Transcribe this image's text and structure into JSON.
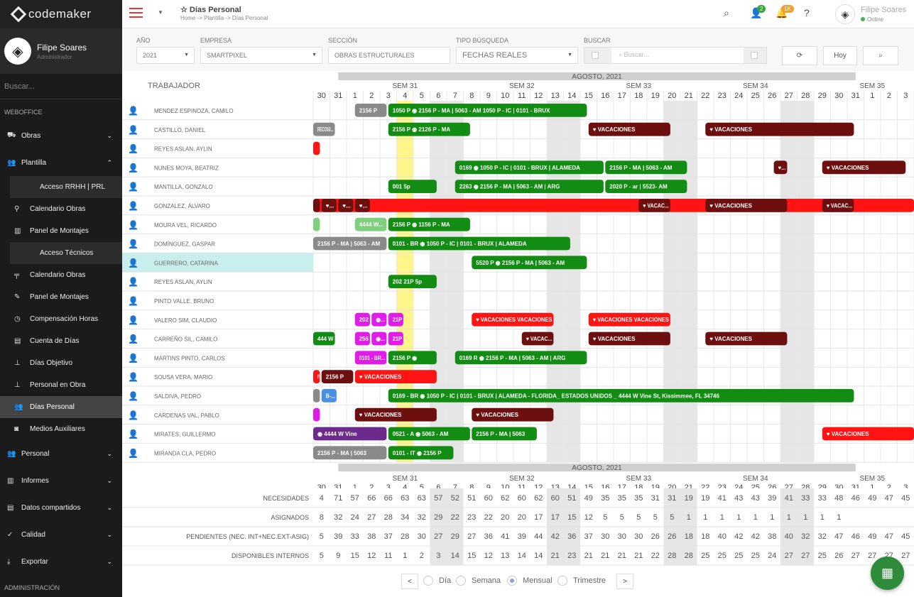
{
  "app": {
    "logo_text": "codemaker",
    "title": "Días Personal",
    "breadcrumb": "Home -> Plantilla -> Días Personal"
  },
  "colors": {
    "sidebar": "#1b1b1b",
    "accent": "#e53935",
    "green": "#138c13",
    "darkred": "#6e0f0f",
    "red": "#ff1414",
    "magenta": "#e11be8",
    "gray": "#8a8a8a",
    "purple": "#6b2a8c",
    "blue": "#4a90e2",
    "weekend": "#e6e6e6",
    "today": "#fff58a"
  },
  "sidebar": {
    "user_name": "Filipe Soares",
    "user_role": "Administrador",
    "search_placeholder": "Buscar...",
    "section1": "WEBOFFICE",
    "section2": "ADMINISTRACIÓN",
    "items": [
      {
        "label": "Obras",
        "icon": "truck-icon",
        "glyph": "⛟",
        "chevron": "⌄",
        "kind": "item"
      },
      {
        "label": "Plantilla",
        "icon": "users-icon",
        "glyph": "👥",
        "chevron": "⌃",
        "kind": "item"
      },
      {
        "label": "Acceso RRHH | PRL",
        "kind": "box"
      },
      {
        "label": "Calendario Obras",
        "icon": "map-pin-icon",
        "glyph": "⚲",
        "kind": "sub"
      },
      {
        "label": "Panel de Montajes",
        "icon": "chart-icon",
        "glyph": "▥",
        "kind": "sub"
      },
      {
        "label": "Acceso Técnicos",
        "kind": "box"
      },
      {
        "label": "Calendario Obras",
        "icon": "tool-icon",
        "glyph": "╤",
        "kind": "sub"
      },
      {
        "label": "Panel de Montajes",
        "icon": "pencil-icon",
        "glyph": "✎",
        "kind": "sub"
      },
      {
        "label": "Compensación Horas",
        "icon": "clock-icon",
        "glyph": "◷",
        "kind": "sub"
      },
      {
        "label": "Cuenta de Días",
        "icon": "calendar-icon",
        "glyph": "▤",
        "kind": "sub"
      },
      {
        "label": "Días Objetivo",
        "icon": "sitemap-icon",
        "glyph": "⊥",
        "kind": "sub"
      },
      {
        "label": "Personal en Obra",
        "icon": "sitemap-icon",
        "glyph": "⊥",
        "kind": "sub"
      },
      {
        "label": "Días Personal",
        "icon": "users-cog-icon",
        "glyph": "👥",
        "kind": "sub",
        "active": true
      },
      {
        "label": "Medios Auxiliares",
        "icon": "car-icon",
        "glyph": "◙",
        "kind": "sub"
      },
      {
        "label": "Personal",
        "icon": "user-group-icon",
        "glyph": "👥",
        "chevron": "⌄",
        "kind": "item"
      },
      {
        "label": "Informes",
        "icon": "bar-chart-icon",
        "glyph": "▥",
        "chevron": "⌄",
        "kind": "item"
      },
      {
        "label": "Datos compartidos",
        "icon": "database-icon",
        "glyph": "▤",
        "chevron": "⌄",
        "kind": "item"
      },
      {
        "label": "Calidad",
        "icon": "award-icon",
        "glyph": "✓",
        "chevron": "⌄",
        "kind": "item"
      },
      {
        "label": "Exportar",
        "icon": "download-icon",
        "glyph": "⤓",
        "chevron": "⌄",
        "kind": "item"
      }
    ]
  },
  "topbar": {
    "user_name": "Filipe Soares",
    "user_status": "Online",
    "badge_users": "2",
    "badge_alerts": "1K"
  },
  "filters": {
    "anio_label": "AÑO",
    "anio_value": "2021",
    "empresa_label": "EMPRESA",
    "empresa_value": "SMARTPIXEL",
    "seccion_label": "SECCIÓN",
    "seccion_value": "OBRAS ESTRUCTURALES",
    "tipo_label": "TIPO BÚSQUEDA",
    "tipo_value": "FECHAS REALES",
    "buscar_label": "BUSCAR",
    "buscar_placeholder": "Buscar...",
    "today_label": "Hoy"
  },
  "calendar": {
    "header_worker": "TRABAJADOR",
    "month": "AGOSTO, 2021",
    "days": [
      "30",
      "31",
      "1",
      "2",
      "3",
      "4",
      "5",
      "6",
      "7",
      "8",
      "9",
      "10",
      "11",
      "12",
      "13",
      "14",
      "15",
      "16",
      "17",
      "18",
      "19",
      "20",
      "21",
      "22",
      "23",
      "24",
      "25",
      "26",
      "27",
      "28",
      "29",
      "30",
      "31",
      "1",
      "2",
      "3"
    ],
    "weekend_idx": [
      7,
      8,
      14,
      15,
      21,
      22,
      28,
      29
    ],
    "today_idx": 5,
    "weeks": [
      {
        "label": "SEM 31",
        "day": 5
      },
      {
        "label": "SEM 32",
        "day": 12
      },
      {
        "label": "SEM 33",
        "day": 19
      },
      {
        "label": "SEM 34",
        "day": 26
      },
      {
        "label": "SEM 35",
        "day": 33
      }
    ],
    "workers": [
      {
        "name": "MENDEZ ESPINOZA, CAMILO",
        "events": [
          {
            "s": -1,
            "e": 0,
            "c": "#6ad2d2",
            "t": ""
          },
          {
            "s": 2.5,
            "e": 4.4,
            "c": "#8a8a8a",
            "t": "2156 P"
          },
          {
            "s": 4.5,
            "e": 16.4,
            "c": "#138c13",
            "t": "1050 P  ◉  2156 P - MA | 5063 - AM  1050 P - IC | 0101 - BRUX"
          }
        ]
      },
      {
        "name": "CASTILLO, DANIEL",
        "events": [
          {
            "s": -1,
            "e": 1.3,
            "c": "#8a8a8a",
            "t": "RECOGI..."
          },
          {
            "s": 4.5,
            "e": 9.4,
            "c": "#138c13",
            "t": "2156 P  ◉  2126 P - MA"
          },
          {
            "s": 16.5,
            "e": 21.4,
            "c": "#6e0f0f",
            "t": "♥ VACACIONES"
          },
          {
            "s": 23.5,
            "e": 32.4,
            "c": "#6e0f0f",
            "t": "♥ VACACIONES"
          }
        ]
      },
      {
        "name": "REYES ASLAN, AYLIN",
        "events": [
          {
            "s": -1,
            "e": 0.4,
            "c": "#ff1414",
            "t": ""
          }
        ]
      },
      {
        "name": "NUNES MOYA, BEATRIZ",
        "events": [
          {
            "s": 8.5,
            "e": 17.4,
            "c": "#138c13",
            "t": "0169  ◉  1050 P - IC | 0101 - BRUX | ALAMEDA"
          },
          {
            "s": 17.5,
            "e": 22.4,
            "c": "#138c13",
            "t": "2156 P - MA | 5063 - AM"
          },
          {
            "s": 27.6,
            "e": 28.4,
            "c": "#6e0f0f",
            "t": "♥..."
          },
          {
            "s": 30.5,
            "e": 35.5,
            "c": "#6e0f0f",
            "t": "♥ VACACIONES"
          }
        ]
      },
      {
        "name": "MANTILLA, GONZALO",
        "events": [
          {
            "s": 4.5,
            "e": 7.4,
            "c": "#138c13",
            "t": "001  5p"
          },
          {
            "s": 8.5,
            "e": 17.4,
            "c": "#138c13",
            "t": "2263  ◉  2156 P - MA | 5063 - AM | ARG"
          },
          {
            "s": 17.5,
            "e": 22.4,
            "c": "#138c13",
            "t": "2020 P - ar | 5523- AM"
          }
        ]
      },
      {
        "name": "GONZALEZ, ÁLVARO",
        "events": [
          {
            "s": -1,
            "e": 37,
            "c": "#ff1414",
            "t": ""
          },
          {
            "s": -1,
            "e": 0.4,
            "c": "#6e0f0f",
            "t": ""
          },
          {
            "s": 0.5,
            "e": 1.4,
            "c": "#6e0f0f",
            "t": "♥..."
          },
          {
            "s": 1.5,
            "e": 2.4,
            "c": "#6e0f0f",
            "t": "♥..."
          },
          {
            "s": 2.5,
            "e": 3.4,
            "c": "#6e0f0f",
            "t": "♥..."
          },
          {
            "s": 19.5,
            "e": 21.4,
            "c": "#6e0f0f",
            "t": "♥ VACAC..."
          },
          {
            "s": 23.5,
            "e": 28.4,
            "c": "#6e0f0f",
            "t": "♥ VACACIONES"
          },
          {
            "s": 30.5,
            "e": 32.4,
            "c": "#6e0f0f",
            "t": "♥ VACAC..."
          }
        ]
      },
      {
        "name": "MOURA VEL, RICARDO",
        "events": [
          {
            "s": -1,
            "e": 0.4,
            "c": "#7ed07e",
            "t": ""
          },
          {
            "s": 2.5,
            "e": 4.4,
            "c": "#7ed07e",
            "t": "4444 W..."
          },
          {
            "s": 4.5,
            "e": 9.4,
            "c": "#138c13",
            "t": "2156 P  ◉  1156 P - MA"
          }
        ]
      },
      {
        "name": "DOMÍNGUEZ, GASPAR",
        "events": [
          {
            "s": -1,
            "e": 4.4,
            "c": "#8a8a8a",
            "t": "2156 P - MA | 5063 - AM"
          },
          {
            "s": 4.5,
            "e": 15.4,
            "c": "#138c13",
            "t": "0101 - BR ◉  1050 P - IC | 0101 - BRUX | ALAMEDA"
          }
        ]
      },
      {
        "name": "GUERRERO, CATARINA",
        "events": [
          {
            "s": 9.5,
            "e": 16.4,
            "c": "#138c13",
            "t": "5520 P  ◉  2156 P - MA | 5063 - AM"
          }
        ],
        "highlight": true
      },
      {
        "name": "REYES ASLAN, AYLIN",
        "events": [
          {
            "s": 4.5,
            "e": 7.4,
            "c": "#138c13",
            "t": "202  21P  5p"
          }
        ]
      },
      {
        "name": "PINTO VALLE, BRUNO",
        "events": []
      },
      {
        "name": "VALERO SIM, CLAUDIO",
        "events": [
          {
            "s": 2.5,
            "e": 3.4,
            "c": "#e11be8",
            "t": "202"
          },
          {
            "s": 3.5,
            "e": 4.4,
            "c": "#e11be8",
            "t": "◉..."
          },
          {
            "s": 4.5,
            "e": 5.4,
            "c": "#e11be8",
            "t": "21P"
          },
          {
            "s": 9.5,
            "e": 14.4,
            "c": "#ff1414",
            "t": "♥ VACACIONES VACACIONES"
          },
          {
            "s": 16.5,
            "e": 21.4,
            "c": "#ff1414",
            "t": "♥ VACACIONES VACACIONES"
          }
        ]
      },
      {
        "name": "CARREÑO SIL, CAMILO",
        "events": [
          {
            "s": -1,
            "e": 1.3,
            "c": "#138c13",
            "t": "444 W"
          },
          {
            "s": 2.5,
            "e": 3.4,
            "c": "#e11be8",
            "t": "256"
          },
          {
            "s": 3.5,
            "e": 4.4,
            "c": "#e11be8",
            "t": "◉..."
          },
          {
            "s": 4.5,
            "e": 5.4,
            "c": "#e11be8",
            "t": "21P"
          },
          {
            "s": 12.5,
            "e": 14.4,
            "c": "#6e0f0f",
            "t": "♥ VACAC..."
          },
          {
            "s": 16.5,
            "e": 21.4,
            "c": "#6e0f0f",
            "t": "♥ VACACIONES"
          },
          {
            "s": 23.5,
            "e": 28.4,
            "c": "#6e0f0f",
            "t": "♥ VACACIONES"
          }
        ]
      },
      {
        "name": "MARTINS PINTO, CARLOS",
        "events": [
          {
            "s": 2.5,
            "e": 4.4,
            "c": "#e11be8",
            "t": "0101 - BR..."
          },
          {
            "s": 4.5,
            "e": 7.4,
            "c": "#138c13",
            "t": "2156 P  ◉"
          },
          {
            "s": 8.5,
            "e": 16.4,
            "c": "#138c13",
            "t": "0169 R  ◉  2156 P - MA | 5063 - AM | ARG"
          }
        ]
      },
      {
        "name": "SOUSA VERA, MARIO",
        "events": [
          {
            "s": -1,
            "e": 0.4,
            "c": "#ff1414",
            "t": "P..."
          },
          {
            "s": 0.5,
            "e": 2.4,
            "c": "#6e0f0f",
            "t": "2156 P"
          },
          {
            "s": 2.5,
            "e": 7.4,
            "c": "#ff1414",
            "t": "♥ VACACIONES"
          }
        ]
      },
      {
        "name": "SALDIVA, PEDRO",
        "events": [
          {
            "s": -1,
            "e": 0.4,
            "c": "#8a8a8a",
            "t": ""
          },
          {
            "s": 0.5,
            "e": 1.4,
            "c": "#4a90e2",
            "t": "B-..."
          },
          {
            "s": 4.5,
            "e": 32.4,
            "c": "#138c13",
            "t": "0169 - BR ◉  1050 P - IC | 0101 - BRUX | ALAMEDA - FLORIDA_ ESTADOS UNIDOS  _ 4444 W Vine St, Kissimmee, FL 34746"
          }
        ]
      },
      {
        "name": "CARDENAS VAL, PABLO",
        "events": [
          {
            "s": -1,
            "e": 0.4,
            "c": "#e11be8",
            "t": ""
          },
          {
            "s": 2.5,
            "e": 7.4,
            "c": "#6e0f0f",
            "t": "♥ VACACIONES"
          },
          {
            "s": 9.5,
            "e": 14.4,
            "c": "#6e0f0f",
            "t": "♥ VACACIONES"
          }
        ]
      },
      {
        "name": "MIRATES, GUILLERMO",
        "events": [
          {
            "s": -1,
            "e": 4.4,
            "c": "#6b2a8c",
            "t": "◉  4444 W Vine"
          },
          {
            "s": 4.5,
            "e": 9.4,
            "c": "#138c13",
            "t": "0521 - A ◉  5063 - AM"
          },
          {
            "s": 9.5,
            "e": 13.4,
            "c": "#138c13",
            "t": "2156 P - MA | 5063"
          },
          {
            "s": 30.5,
            "e": 37,
            "c": "#ff1414",
            "t": "♥ VACACIONES"
          }
        ]
      },
      {
        "name": "MIRANDA CLA, PEDRO",
        "events": [
          {
            "s": -1,
            "e": 4.4,
            "c": "#8a8a8a",
            "t": "2156 P - MA | 5063"
          },
          {
            "s": 4.5,
            "e": 8.4,
            "c": "#138c13",
            "t": "0101 - IT ◉  2156 P"
          }
        ]
      }
    ],
    "summary": [
      {
        "label": "NECESIDADES",
        "values": [
          "4",
          "71",
          "57",
          "66",
          "66",
          "63",
          "63",
          "57",
          "52",
          "51",
          "60",
          "62",
          "60",
          "62",
          "60",
          "51",
          "49",
          "35",
          "35",
          "35",
          "31",
          "31",
          "19",
          "19",
          "41",
          "43",
          "43",
          "39",
          "41",
          "33",
          "33",
          "48",
          "46",
          "49",
          "47",
          "45"
        ]
      },
      {
        "label": "ASIGNADOS",
        "values": [
          "8",
          "32",
          "24",
          "27",
          "28",
          "34",
          "32",
          "29",
          "22",
          "23",
          "22",
          "20",
          "20",
          "17",
          "17",
          "15",
          "12",
          "5",
          "5",
          "5",
          "5",
          "5",
          "1",
          "1",
          "1",
          "1",
          "1",
          "1",
          "1",
          "1",
          "1",
          "1",
          "",
          "",
          "",
          ""
        ]
      },
      {
        "label": "PENDIENTES (NEC. INT+NEC.EXT-ASIG)",
        "values": [
          "5",
          "39",
          "33",
          "38",
          "37",
          "28",
          "30",
          "27",
          "29",
          "27",
          "36",
          "41",
          "39",
          "44",
          "42",
          "36",
          "37",
          "30",
          "30",
          "30",
          "26",
          "26",
          "18",
          "18",
          "40",
          "42",
          "42",
          "38",
          "40",
          "32",
          "32",
          "47",
          "46",
          "49",
          "47",
          "45"
        ]
      },
      {
        "label": "DISPONIBLES INTERNOS",
        "values": [
          "5",
          "9",
          "15",
          "12",
          "11",
          "1",
          "2",
          "3",
          "14",
          "15",
          "12",
          "13",
          "14",
          "14",
          "21",
          "23",
          "21",
          "21",
          "21",
          "21",
          "22",
          "28",
          "28",
          "25",
          "25",
          "25",
          "25",
          "24",
          "27",
          "27",
          "25",
          "26",
          "27",
          "27",
          "27",
          "27"
        ]
      }
    ]
  },
  "pager": {
    "prev": "<",
    "next": ">",
    "options": [
      "Día",
      "Semana",
      "Mensual",
      "Trimestre"
    ],
    "selected": 2
  }
}
